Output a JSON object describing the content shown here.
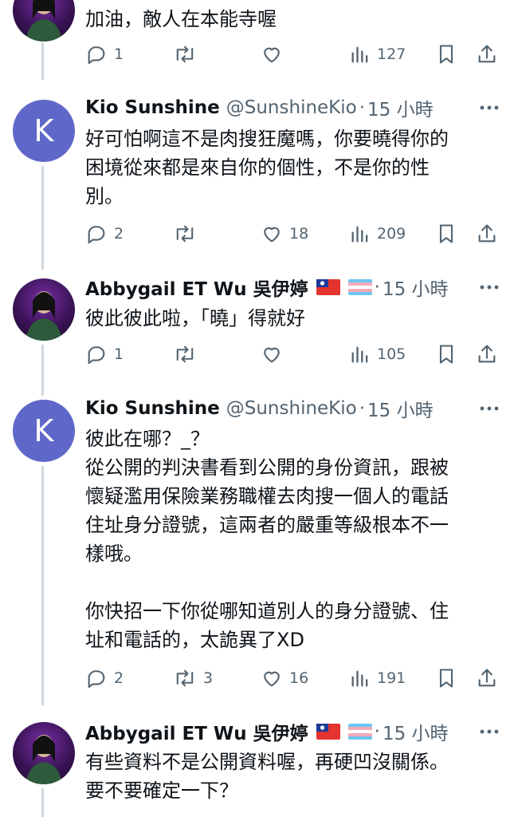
{
  "tweets": [
    {
      "avatar": "photo",
      "body": "加油，敵人在本能寺喔",
      "stats": {
        "reply": "1",
        "retweet": "",
        "like": "",
        "views": "127"
      }
    },
    {
      "avatar": "K",
      "name": "Kio Sunshine",
      "handle": "@SunshineKio",
      "time": "15 小時",
      "body": "好可怕啊這不是肉搜狂魔嗎，你要曉得你的\n困境從來都是來自你的個性，不是你的性\n別。",
      "stats": {
        "reply": "2",
        "retweet": "",
        "like": "18",
        "views": "209"
      }
    },
    {
      "avatar": "photo",
      "name": "Abbygail ET Wu 吳伊婷",
      "time": "15 小時",
      "flags": [
        "taiwan-flag",
        "transgender-flag"
      ],
      "body": "彼此彼此啦，「曉」得就好",
      "stats": {
        "reply": "1",
        "retweet": "",
        "like": "",
        "views": "105"
      }
    },
    {
      "avatar": "K",
      "name": "Kio Sunshine",
      "handle": "@SunshineKio",
      "time": "15 小時",
      "body": "彼此在哪？_？\n從公開的判決書看到公開的身份資訊，跟被\n懷疑濫用保險業務職權去肉搜一個人的電話\n住址身分證號，這兩者的嚴重等級根本不一\n樣哦。\n\n你快招一下你從哪知道別人的身分證號、住\n址和電話的，太詭異了XD",
      "stats": {
        "reply": "2",
        "retweet": "3",
        "like": "16",
        "views": "191"
      }
    },
    {
      "avatar": "photo",
      "name": "Abbygail ET Wu 吳伊婷",
      "time": "15 小時",
      "flags": [
        "taiwan-flag",
        "transgender-flag"
      ],
      "body": "有些資料不是公開資料喔，再硬凹沒關係。\n要不要確定一下？"
    }
  ],
  "meta": {
    "dot": "·",
    "avatar_letter": "K"
  },
  "colors": {
    "muted": "#536471",
    "avatar_k": "#5f68c8",
    "thread_line": "#cfd9de"
  }
}
